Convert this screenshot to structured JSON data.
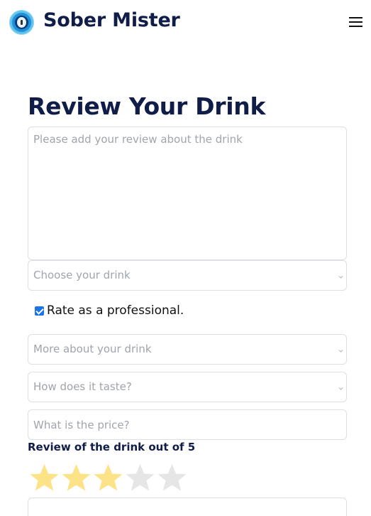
{
  "header": {
    "brand": "Sober Mister",
    "logo_icon": "padlock-logo-icon",
    "menu_icon": "hamburger-menu-icon"
  },
  "page": {
    "title": "Review Your Drink"
  },
  "form": {
    "review_placeholder": "Please add your review about the drink",
    "drink_select_placeholder": "Choose your drink",
    "professional_checkbox_label": "Rate as a professional.",
    "professional_checked": true,
    "more_select_placeholder": "More about your drink",
    "taste_select_placeholder": "How does it taste?",
    "price_placeholder": "What is the price?",
    "rating_label": "Review of the drink out of 5",
    "rating_value": 3,
    "rating_max": 5
  },
  "colors": {
    "star_filled": "#fde387",
    "star_empty": "#e6e6e6",
    "heading": "#0f1d48",
    "checkbox": "#1a73e8"
  }
}
